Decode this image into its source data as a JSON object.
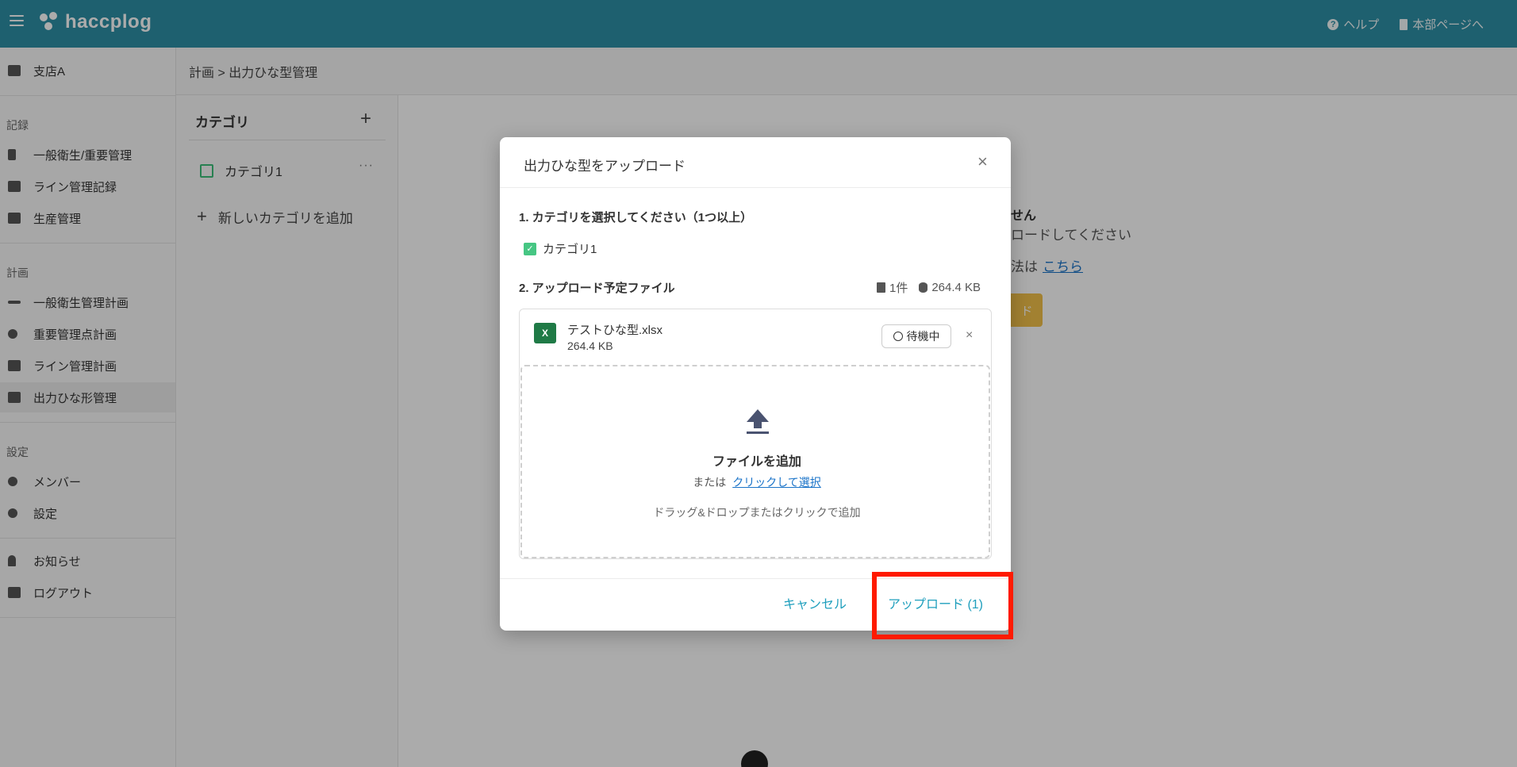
{
  "header": {
    "app_name": "haccplog",
    "links": [
      {
        "label": "ヘルプ",
        "icon": "help-icon"
      },
      {
        "label": "本部ページへ",
        "icon": "building-icon"
      }
    ]
  },
  "sidebar": {
    "store": "支店A",
    "sections": {
      "record": "記録",
      "plan": "計画",
      "settings": "設定"
    },
    "record_items": [
      "一般衛生/重要管理",
      "ライン管理記録",
      "生産管理"
    ],
    "plan_items": [
      "一般衛生管理計画",
      "重要管理点計画",
      "ライン管理計画",
      "出力ひな形管理"
    ],
    "settings_items": [
      "メンバー",
      "設定"
    ],
    "other_items": [
      "お知らせ",
      "ログアウト"
    ]
  },
  "breadcrumb": "計画 > 出力ひな型管理",
  "category_panel": {
    "title": "カテゴリ",
    "add_symbol": "+",
    "items": [
      "カテゴリ1"
    ],
    "more_symbol": "···",
    "add_label": "新しいカテゴリを追加"
  },
  "background": {
    "text1": "せん",
    "text2": "ロードしてください",
    "text3": "法は",
    "link": "こちら",
    "button_fragment": "ド"
  },
  "modal": {
    "title": "出力ひな型をアップロード",
    "close_symbol": "×",
    "step1": "1. カテゴリを選択してください（1つ以上）",
    "category_option": "カテゴリ1",
    "step2": "2. アップロード予定ファイル",
    "file_count": "1件",
    "total_size": "264.4 KB",
    "file": {
      "icon_letter": "X",
      "name": "テストひな型.xlsx",
      "size": "264.4 KB",
      "status": "待機中",
      "remove_symbol": "×"
    },
    "dropzone": {
      "title": "ファイルを追加",
      "or": "または",
      "select_link": "クリックして選択",
      "hint": "ドラッグ&ドロップまたはクリックで追加"
    },
    "cancel_label": "キャンセル",
    "upload_label": "アップロード (1)"
  },
  "colors": {
    "header_bg": "#2e8fa6",
    "accent": "#1f9fbd",
    "checkbox": "#46c683",
    "highlight": "#ff1a00"
  }
}
